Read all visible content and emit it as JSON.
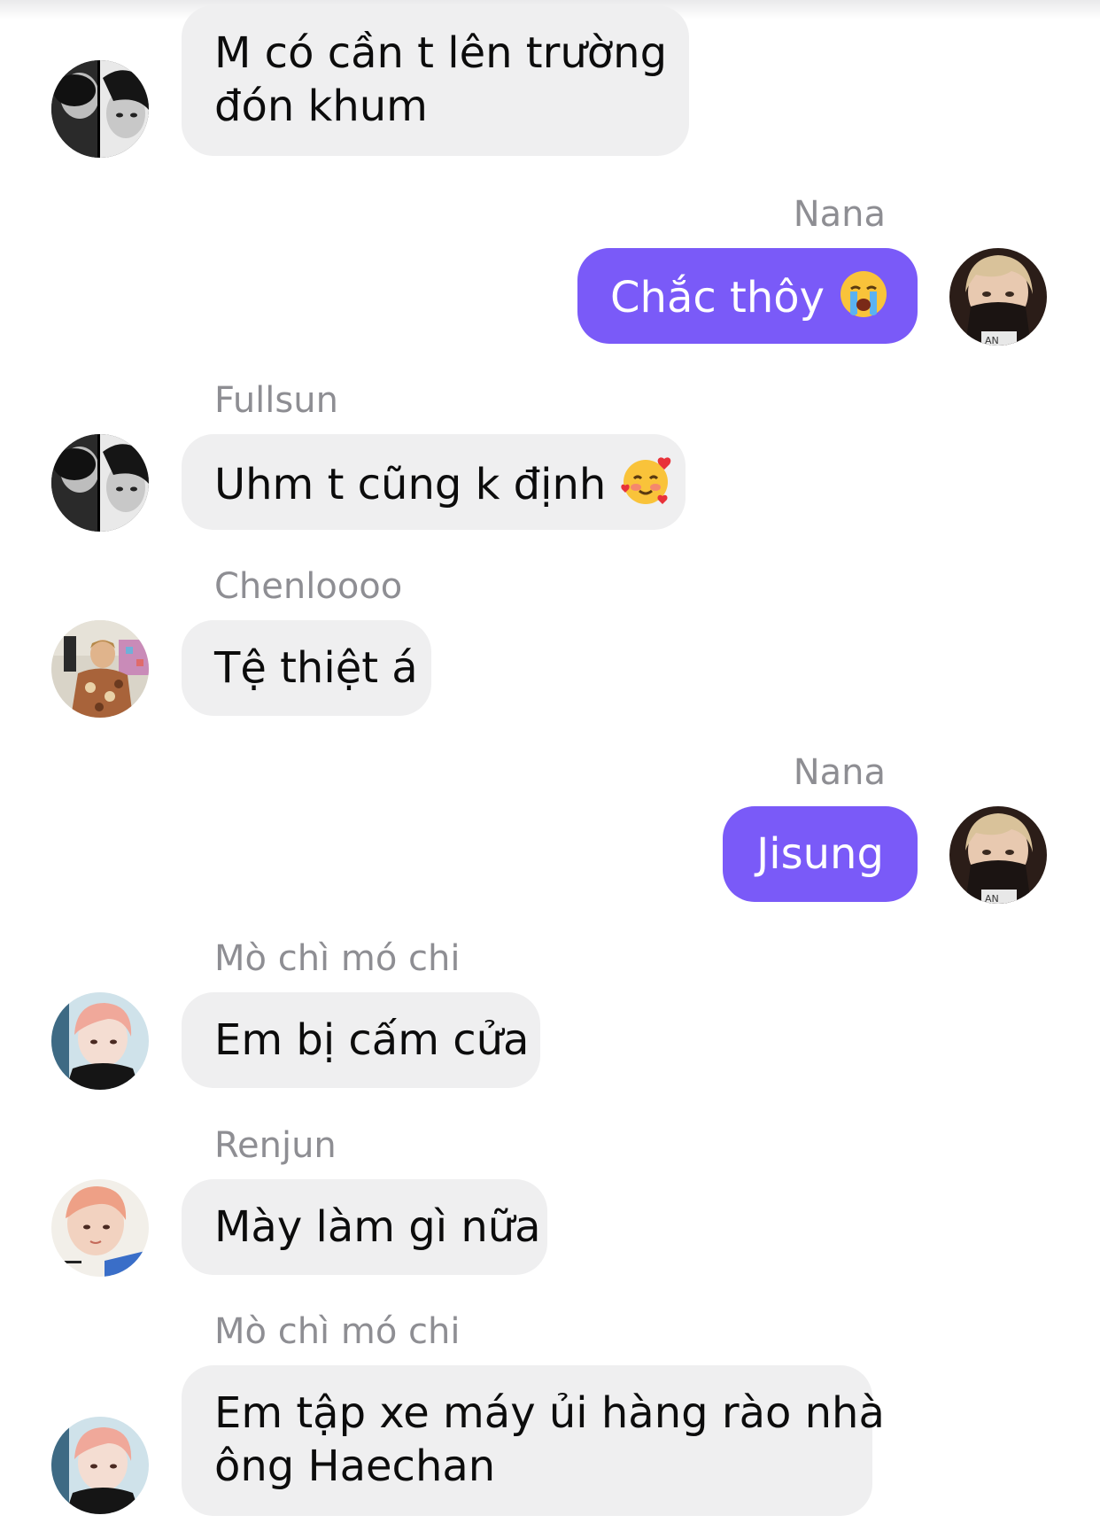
{
  "messages": [
    {
      "sender": "",
      "direction": "incoming",
      "avatar_icon": "bw-photo-avatar",
      "lines": [
        "M có cần t lên trường",
        "đón khum"
      ],
      "emoji": ""
    },
    {
      "sender": "Nana",
      "direction": "outgoing",
      "avatar_icon": "blond-masked-avatar",
      "lines": [
        "Chắc thôy"
      ],
      "emoji": "crying-face-emoji"
    },
    {
      "sender": "Fullsun",
      "direction": "incoming",
      "avatar_icon": "bw-photo-avatar",
      "lines": [
        "Uhm t cũng k định"
      ],
      "emoji": "smiling-face-with-hearts-emoji"
    },
    {
      "sender": "Chenloooo",
      "direction": "incoming",
      "avatar_icon": "colorful-room-avatar",
      "lines": [
        "Tệ thiệt á"
      ],
      "emoji": ""
    },
    {
      "sender": "Nana",
      "direction": "outgoing",
      "avatar_icon": "blond-masked-avatar",
      "lines": [
        "Jisung"
      ],
      "emoji": ""
    },
    {
      "sender": "Mò chì mó chi",
      "direction": "incoming",
      "avatar_icon": "pink-hair-avatar",
      "lines": [
        "Em bị cấm cửa"
      ],
      "emoji": ""
    },
    {
      "sender": "Renjun",
      "direction": "incoming",
      "avatar_icon": "pink-hair-avatar",
      "lines": [
        "Mày làm gì nữa"
      ],
      "emoji": ""
    },
    {
      "sender": "Mò chì mó chi",
      "direction": "incoming",
      "avatar_icon": "pink-hair-avatar",
      "lines": [
        "Em tập xe máy ủi hàng rào nhà",
        "ông Haechan"
      ],
      "emoji": ""
    }
  ],
  "colors": {
    "outgoing_bubble": "#7a5af8",
    "incoming_bubble": "#efeff0",
    "sender_name": "#8e8e93"
  }
}
